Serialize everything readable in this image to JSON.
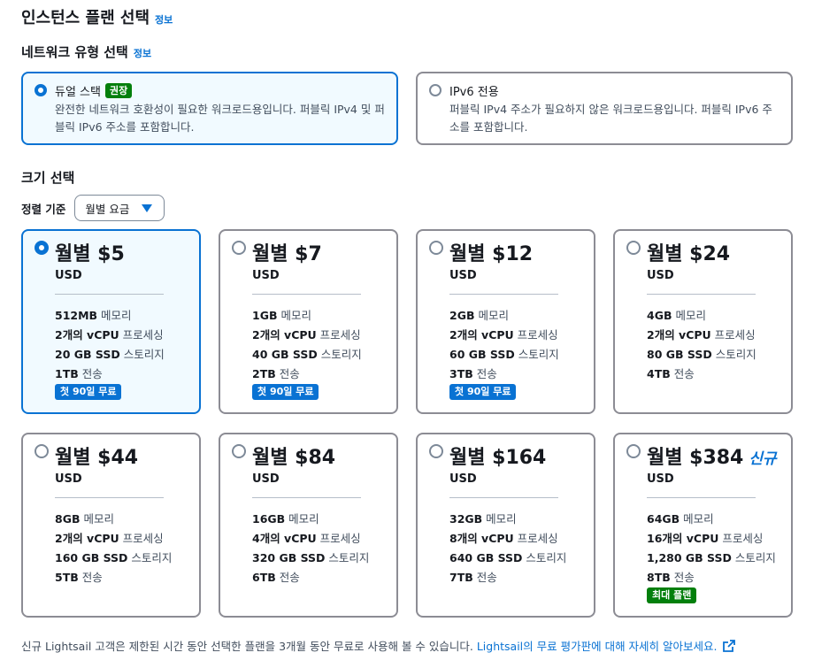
{
  "header": {
    "title": "인스턴스 플랜 선택",
    "info": "정보"
  },
  "network": {
    "title": "네트워크 유형 선택",
    "info": "정보",
    "options": [
      {
        "label": "듀얼 스택",
        "badge": "권장",
        "desc": "완전한 네트워크 호환성이 필요한 워크로드용입니다. 퍼블릭 IPv4 및 퍼블릭 IPv6 주소를 포함합니다.",
        "selected": true
      },
      {
        "label": "IPv6 전용",
        "badge": "",
        "desc": "퍼블릭 IPv4 주소가 필요하지 않은 워크로드용입니다. 퍼블릭 IPv6 주소를 포함합니다.",
        "selected": false
      }
    ]
  },
  "size": {
    "title": "크기 선택",
    "sort_label": "정렬 기준",
    "sort_value": "월별 요금"
  },
  "spec_labels": {
    "memory": "메모리",
    "cpu": "프로세싱",
    "ssd": "스토리지",
    "transfer": "전송"
  },
  "plans": [
    {
      "price": "월별 $5",
      "currency": "USD",
      "memory": "512MB",
      "cpu": "2개의 vCPU",
      "ssd": "20 GB SSD",
      "transfer": "1TB",
      "badge": "첫 90일 무료",
      "badge_color": "#0972d3",
      "new": "",
      "selected": true
    },
    {
      "price": "월별 $7",
      "currency": "USD",
      "memory": "1GB",
      "cpu": "2개의 vCPU",
      "ssd": "40 GB SSD",
      "transfer": "2TB",
      "badge": "첫 90일 무료",
      "badge_color": "#0972d3",
      "new": "",
      "selected": false
    },
    {
      "price": "월별 $12",
      "currency": "USD",
      "memory": "2GB",
      "cpu": "2개의 vCPU",
      "ssd": "60 GB SSD",
      "transfer": "3TB",
      "badge": "첫 90일 무료",
      "badge_color": "#0972d3",
      "new": "",
      "selected": false
    },
    {
      "price": "월별 $24",
      "currency": "USD",
      "memory": "4GB",
      "cpu": "2개의 vCPU",
      "ssd": "80 GB SSD",
      "transfer": "4TB",
      "badge": "",
      "badge_color": "",
      "new": "",
      "selected": false
    },
    {
      "price": "월별 $44",
      "currency": "USD",
      "memory": "8GB",
      "cpu": "2개의 vCPU",
      "ssd": "160 GB SSD",
      "transfer": "5TB",
      "badge": "",
      "badge_color": "",
      "new": "",
      "selected": false
    },
    {
      "price": "월별 $84",
      "currency": "USD",
      "memory": "16GB",
      "cpu": "4개의 vCPU",
      "ssd": "320 GB SSD",
      "transfer": "6TB",
      "badge": "",
      "badge_color": "",
      "new": "",
      "selected": false
    },
    {
      "price": "월별 $164",
      "currency": "USD",
      "memory": "32GB",
      "cpu": "8개의 vCPU",
      "ssd": "640 GB SSD",
      "transfer": "7TB",
      "badge": "",
      "badge_color": "",
      "new": "",
      "selected": false
    },
    {
      "price": "월별 $384",
      "currency": "USD",
      "memory": "64GB",
      "cpu": "16개의 vCPU",
      "ssd": "1,280 GB SSD",
      "transfer": "8TB",
      "badge": "최대 플랜",
      "badge_color": "#037f0c",
      "new": "신규",
      "selected": false
    }
  ],
  "footer": {
    "text": "신규 Lightsail 고객은 제한된 시간 동안 선택한 플랜을 3개월 동안 무료로 사용해 볼 수 있습니다. ",
    "link": "Lightsail의 무료 평가판에 대해 자세히 알아보세요.",
    "link_icon": "external-link-icon"
  }
}
